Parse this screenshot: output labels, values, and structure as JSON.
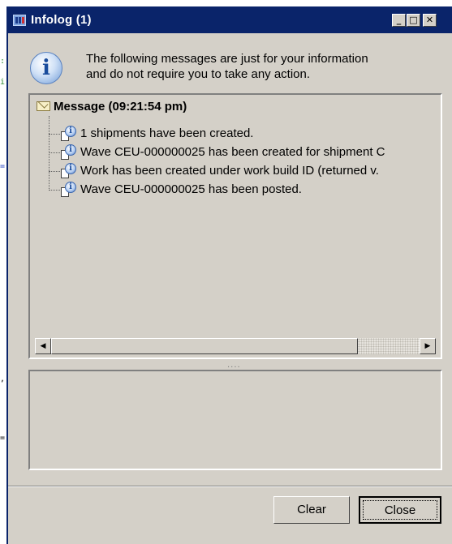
{
  "window": {
    "title": "Infolog (1)",
    "controls": {
      "minimize": "_",
      "maximize": "□",
      "close": "✕"
    }
  },
  "info": {
    "icon": "info-icon",
    "line1": "The following messages are just for your information",
    "line2": "and do not require you to take any action."
  },
  "tree": {
    "header": "Message (09:21:54 pm)",
    "items": [
      {
        "text": "1 shipments have been created."
      },
      {
        "text": "Wave CEU-000000025 has been created for shipment C"
      },
      {
        "text": "Work has been created under work build ID (returned v."
      },
      {
        "text": "Wave CEU-000000025 has been posted."
      }
    ],
    "scroll_left": "◀",
    "scroll_right": "▶"
  },
  "splitter": "....",
  "buttons": {
    "clear": "Clear",
    "close": "Close"
  }
}
